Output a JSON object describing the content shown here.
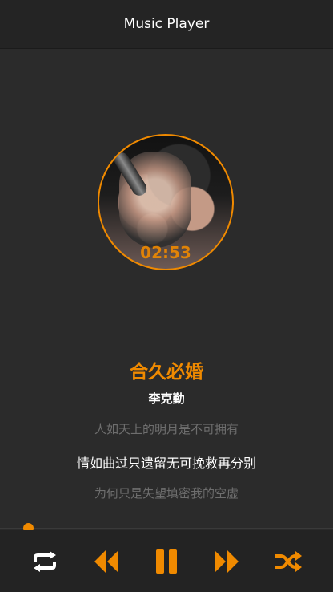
{
  "header": {
    "title": "Music Player"
  },
  "player": {
    "elapsed_time": "02:53",
    "song_title": "合久必婚",
    "artist": "李克勤",
    "lyrics": {
      "previous": "人如天上的明月是不可拥有",
      "current": "情如曲过只遗留无可挽救再分别",
      "next": "为何只是失望填密我的空虚"
    },
    "progress_fraction": 0.07
  },
  "controls": {
    "repeat_icon": "repeat-icon",
    "previous_icon": "rewind-icon",
    "pause_icon": "pause-icon",
    "next_icon": "fast-forward-icon",
    "shuffle_icon": "shuffle-icon"
  },
  "colors": {
    "accent": "#f08a00",
    "background": "#2b2b2b",
    "header": "#242424",
    "controls_bar": "#232323"
  }
}
